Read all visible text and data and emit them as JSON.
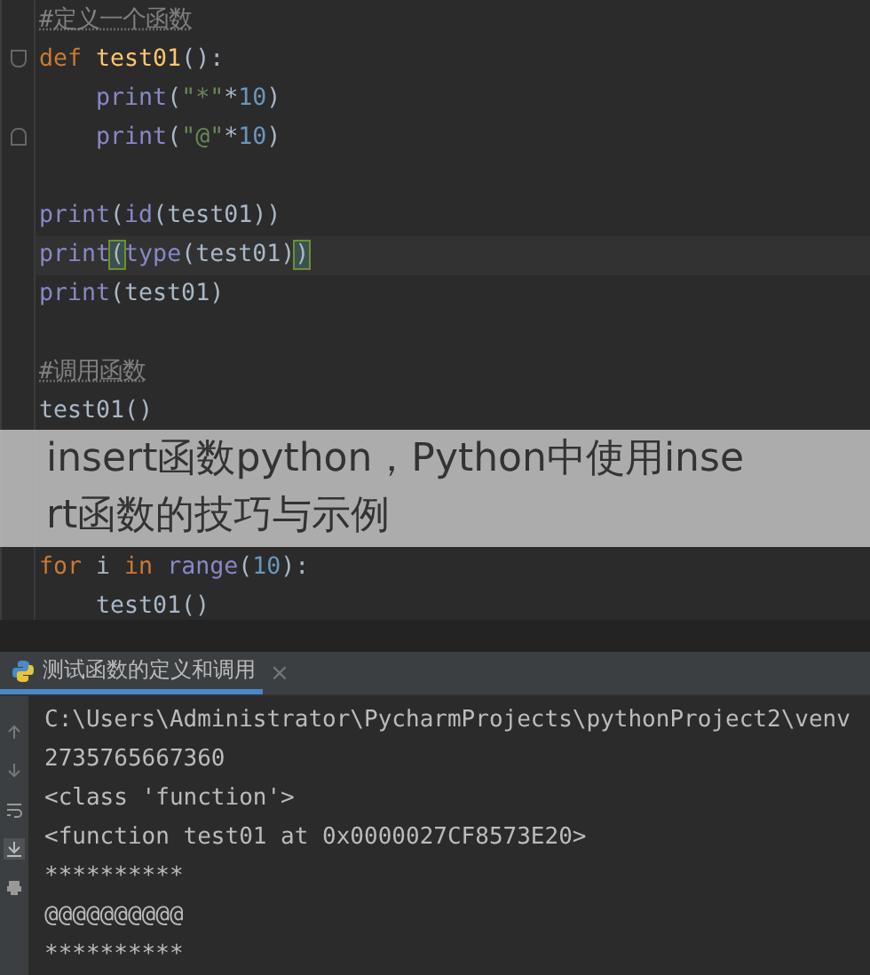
{
  "editor": {
    "lines": [
      {
        "kind": "code",
        "tokens": [
          {
            "text": "#定义一个函数",
            "kind": "comment"
          }
        ]
      },
      {
        "kind": "code",
        "fold_start": true,
        "tokens": [
          {
            "text": "def ",
            "kind": "keyword"
          },
          {
            "text": "test01",
            "kind": "function"
          },
          {
            "text": "():",
            "kind": "plain"
          }
        ]
      },
      {
        "kind": "code",
        "tokens": [
          {
            "text": "    print",
            "kind": "builtin"
          },
          {
            "text": "(",
            "kind": "plain"
          },
          {
            "text": "\"*\"",
            "kind": "string"
          },
          {
            "text": "*",
            "kind": "plain"
          },
          {
            "text": "10",
            "kind": "number"
          },
          {
            "text": ")",
            "kind": "plain"
          }
        ]
      },
      {
        "kind": "code",
        "fold_end": true,
        "tokens": [
          {
            "text": "    print",
            "kind": "builtin"
          },
          {
            "text": "(",
            "kind": "plain"
          },
          {
            "text": "\"@\"",
            "kind": "string"
          },
          {
            "text": "*",
            "kind": "plain"
          },
          {
            "text": "10",
            "kind": "number"
          },
          {
            "text": ")",
            "kind": "plain"
          }
        ]
      },
      {
        "kind": "blank"
      },
      {
        "kind": "code",
        "tokens": [
          {
            "text": "print",
            "kind": "builtin"
          },
          {
            "text": "(",
            "kind": "plain"
          },
          {
            "text": "id",
            "kind": "builtin"
          },
          {
            "text": "(test01))",
            "kind": "plain"
          }
        ]
      },
      {
        "kind": "code",
        "current": true,
        "tokens": [
          {
            "text": "print",
            "kind": "builtin"
          },
          {
            "text": "(",
            "kind": "brace"
          },
          {
            "text": "type",
            "kind": "builtin"
          },
          {
            "text": "(test01)",
            "kind": "plain"
          },
          {
            "text": ")",
            "kind": "brace"
          }
        ]
      },
      {
        "kind": "code",
        "tokens": [
          {
            "text": "print",
            "kind": "builtin"
          },
          {
            "text": "(test01)",
            "kind": "plain"
          }
        ]
      },
      {
        "kind": "blank"
      },
      {
        "kind": "code",
        "tokens": [
          {
            "text": "#调用函数",
            "kind": "comment"
          }
        ]
      },
      {
        "kind": "code",
        "tokens": [
          {
            "text": "test01()",
            "kind": "plain"
          }
        ]
      },
      {
        "kind": "blank"
      },
      {
        "kind": "blank"
      },
      {
        "kind": "blank"
      },
      {
        "kind": "code",
        "tokens": [
          {
            "text": "for ",
            "kind": "keyword"
          },
          {
            "text": "i ",
            "kind": "plain"
          },
          {
            "text": "in ",
            "kind": "keyword"
          },
          {
            "text": "range",
            "kind": "builtin"
          },
          {
            "text": "(",
            "kind": "plain"
          },
          {
            "text": "10",
            "kind": "number"
          },
          {
            "text": "):",
            "kind": "plain"
          }
        ]
      },
      {
        "kind": "code",
        "tokens": [
          {
            "text": "    test01()",
            "kind": "plain"
          }
        ]
      }
    ]
  },
  "banner": {
    "lines": [
      "insert函数python，Python中使用inse",
      "rt函数的技巧与示例"
    ]
  },
  "run_panel": {
    "tab": {
      "label": "测试函数的定义和调用",
      "selected": true,
      "close": "×"
    },
    "output": [
      "C:\\Users\\Administrator\\PycharmProjects\\pythonProject2\\venv",
      "2735765667360",
      "<class 'function'>",
      "<function test01 at 0x0000027CF8573E20>",
      "**********",
      "@@@@@@@@@@",
      "**********"
    ]
  }
}
